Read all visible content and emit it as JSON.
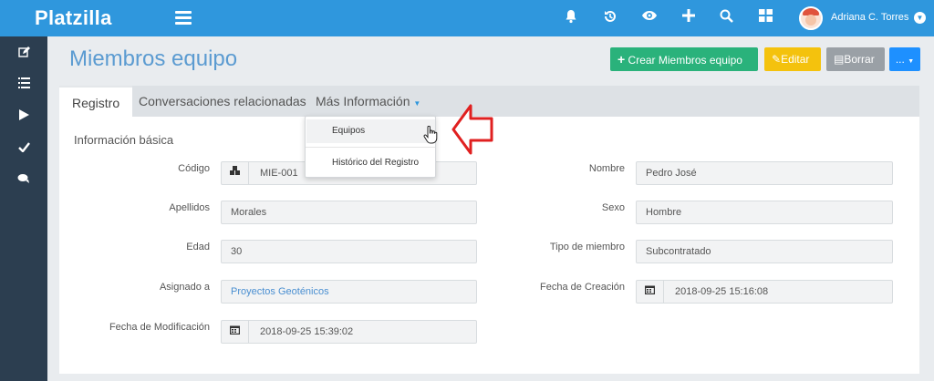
{
  "header": {
    "logo": "Platzilla",
    "user_name": "Adriana C. Torres",
    "icons": [
      "menu-icon",
      "bell-icon",
      "history-icon",
      "eye-icon",
      "plus-icon",
      "search-icon",
      "grid-icon",
      "avatar",
      "chevron-down-icon"
    ]
  },
  "sidebar": {
    "icons": [
      "edit-icon",
      "list-icon",
      "play-icon",
      "check-icon",
      "chat-icon"
    ]
  },
  "page": {
    "title": "Miembros equipo",
    "buttons": {
      "create": "Crear Miembros equipo",
      "edit": "Editar",
      "delete": "Borrar",
      "more": "..."
    }
  },
  "tabs": {
    "registro": "Registro",
    "conversaciones": "Conversaciones relacionadas",
    "mas_info": "Más Información"
  },
  "dropdown": {
    "items": [
      "Equipos",
      "Histórico del Registro"
    ]
  },
  "form": {
    "section_title": "Información básica",
    "fields": {
      "codigo": {
        "label": "Código",
        "value": "MIE-001"
      },
      "apellidos": {
        "label": "Apellidos",
        "value": "Morales"
      },
      "edad": {
        "label": "Edad",
        "value": "30"
      },
      "asignado": {
        "label": "Asignado a",
        "value": "Proyectos Geoténicos"
      },
      "fecha_mod": {
        "label": "Fecha de Modificación",
        "value": "2018-09-25 15:39:02"
      },
      "nombre": {
        "label": "Nombre",
        "value": "Pedro José"
      },
      "sexo": {
        "label": "Sexo",
        "value": "Hombre"
      },
      "tipo": {
        "label": "Tipo de miembro",
        "value": "Subcontratado"
      },
      "fecha_creacion": {
        "label": "Fecha de Creación",
        "value": "2018-09-25 15:16:08"
      }
    }
  },
  "colors": {
    "header": "#2f97dd",
    "sidebar": "#2c3e50",
    "create_button": "#2ab27b",
    "edit_button": "#f4c20d",
    "delete_button": "#9aa0a6",
    "more_button": "#1e90ff",
    "title": "#5b9bd1",
    "annotation_arrow": "#e02020"
  }
}
